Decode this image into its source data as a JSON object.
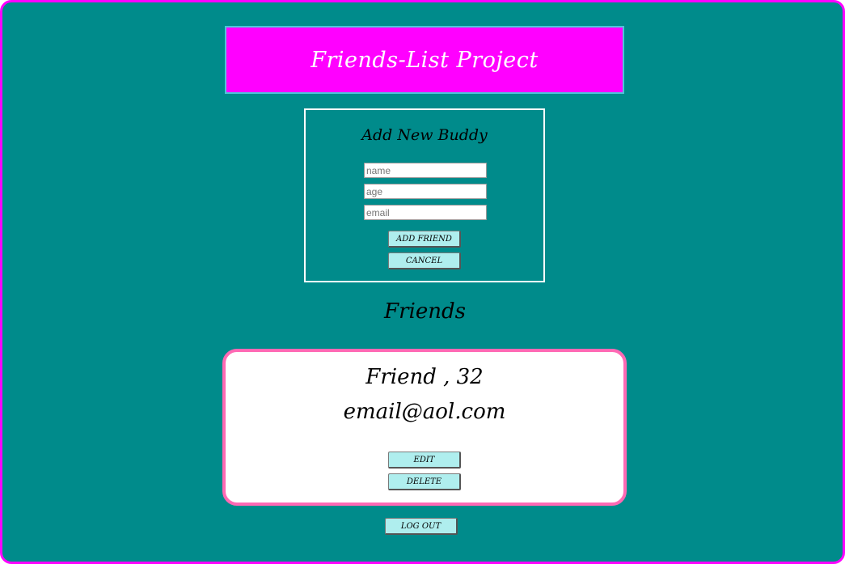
{
  "header": {
    "title": "Friends-List Project"
  },
  "form": {
    "title": "Add New Buddy",
    "fields": {
      "name_placeholder": "name",
      "age_placeholder": "age",
      "email_placeholder": "email"
    },
    "add_label": "ADD FRIEND",
    "cancel_label": "CANCEL"
  },
  "friends": {
    "heading": "Friends",
    "items": [
      {
        "name_age": "Friend , 32",
        "email": "email@aol.com",
        "edit_label": "EDIT",
        "delete_label": "DELETE"
      }
    ]
  },
  "logout_label": "LOG OUT",
  "colors": {
    "background": "#008b8b",
    "frame_border": "#ff00ff",
    "header_bg": "#ff00ff",
    "card_border": "#ff69b4",
    "button_bg": "#afeeee"
  }
}
